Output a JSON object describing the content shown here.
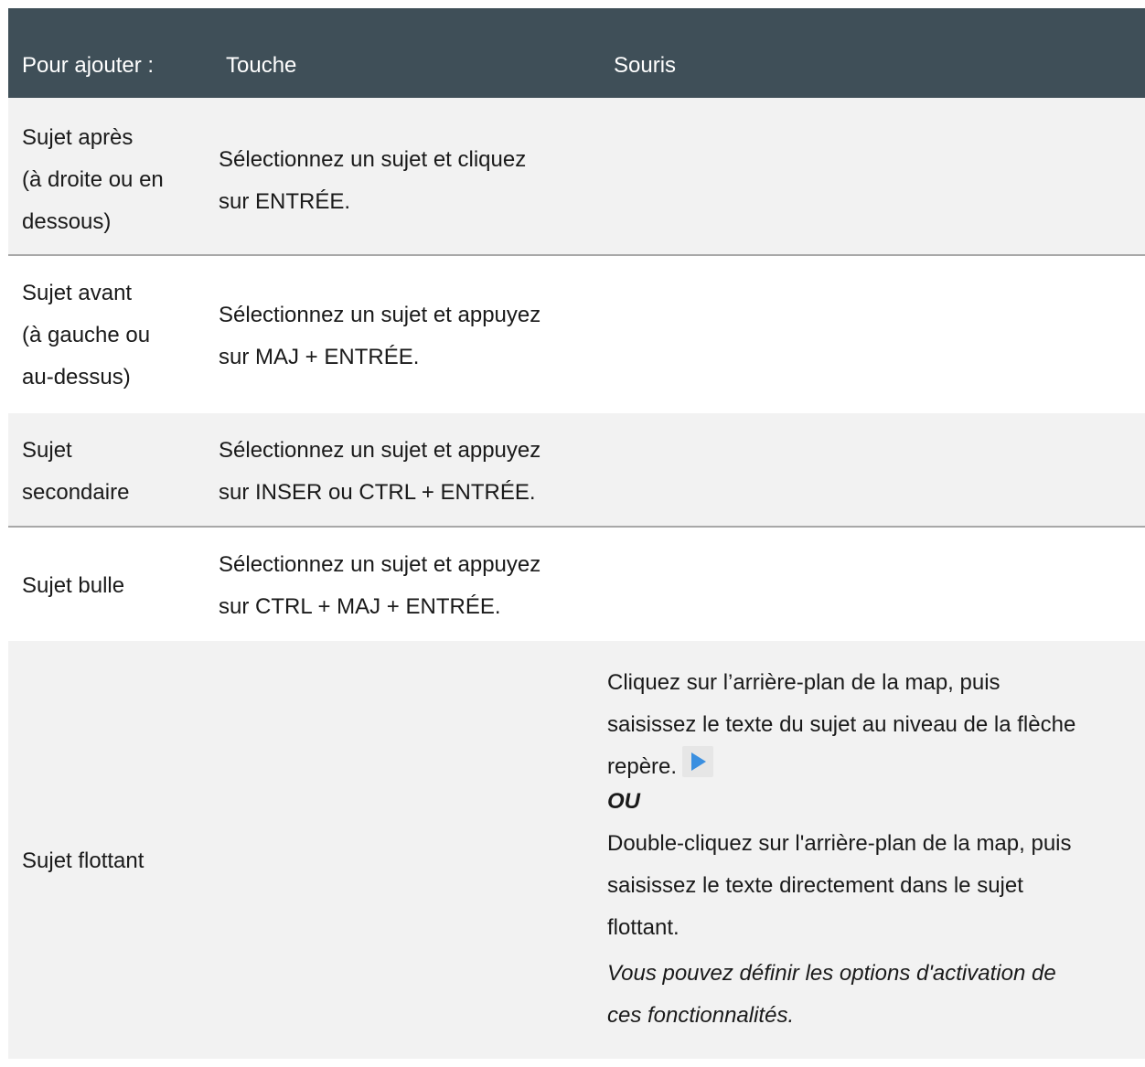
{
  "header": {
    "col1": "Pour ajouter :",
    "col2": "Touche",
    "col3": "Souris"
  },
  "rows": [
    {
      "label_lines": [
        "Sujet après",
        "(à droite ou en",
        "dessous)"
      ],
      "key_lines": [
        "Sélectionnez un sujet et cliquez",
        "sur ENTRÉE."
      ]
    },
    {
      "label_lines": [
        "Sujet avant",
        "(à gauche ou",
        "au-dessus)"
      ],
      "key_lines": [
        "Sélectionnez un sujet et appuyez",
        "sur MAJ + ENTRÉE."
      ]
    },
    {
      "label_lines": [
        "Sujet",
        "secondaire"
      ],
      "key_lines": [
        "Sélectionnez un sujet et appuyez",
        "sur INSER ou CTRL + ENTRÉE."
      ]
    },
    {
      "label_lines": [
        "Sujet bulle"
      ],
      "key_lines": [
        "Sélectionnez un sujet et appuyez",
        "sur CTRL + MAJ + ENTRÉE."
      ]
    },
    {
      "label_lines": [
        "Sujet flottant"
      ],
      "mouse": {
        "line1": "Cliquez sur l’arrière-plan de la map, puis",
        "line2": "saisissez le texte du sujet au niveau de la flèche",
        "line3": "repère.",
        "arrow_icon": "play-arrow-icon",
        "or": "OU",
        "line4": "Double-cliquez sur l'arrière-plan de la map, puis",
        "line5": "saisissez le texte directement dans le sujet",
        "line6": "flottant.",
        "note1": "Vous pouvez définir les options d'activation de",
        "note2": "ces fonctionnalités."
      }
    }
  ],
  "colors": {
    "header_bg": "#3f4f58",
    "alt_row_bg": "#f2f2f2",
    "arrow": "#3a8fe0"
  }
}
